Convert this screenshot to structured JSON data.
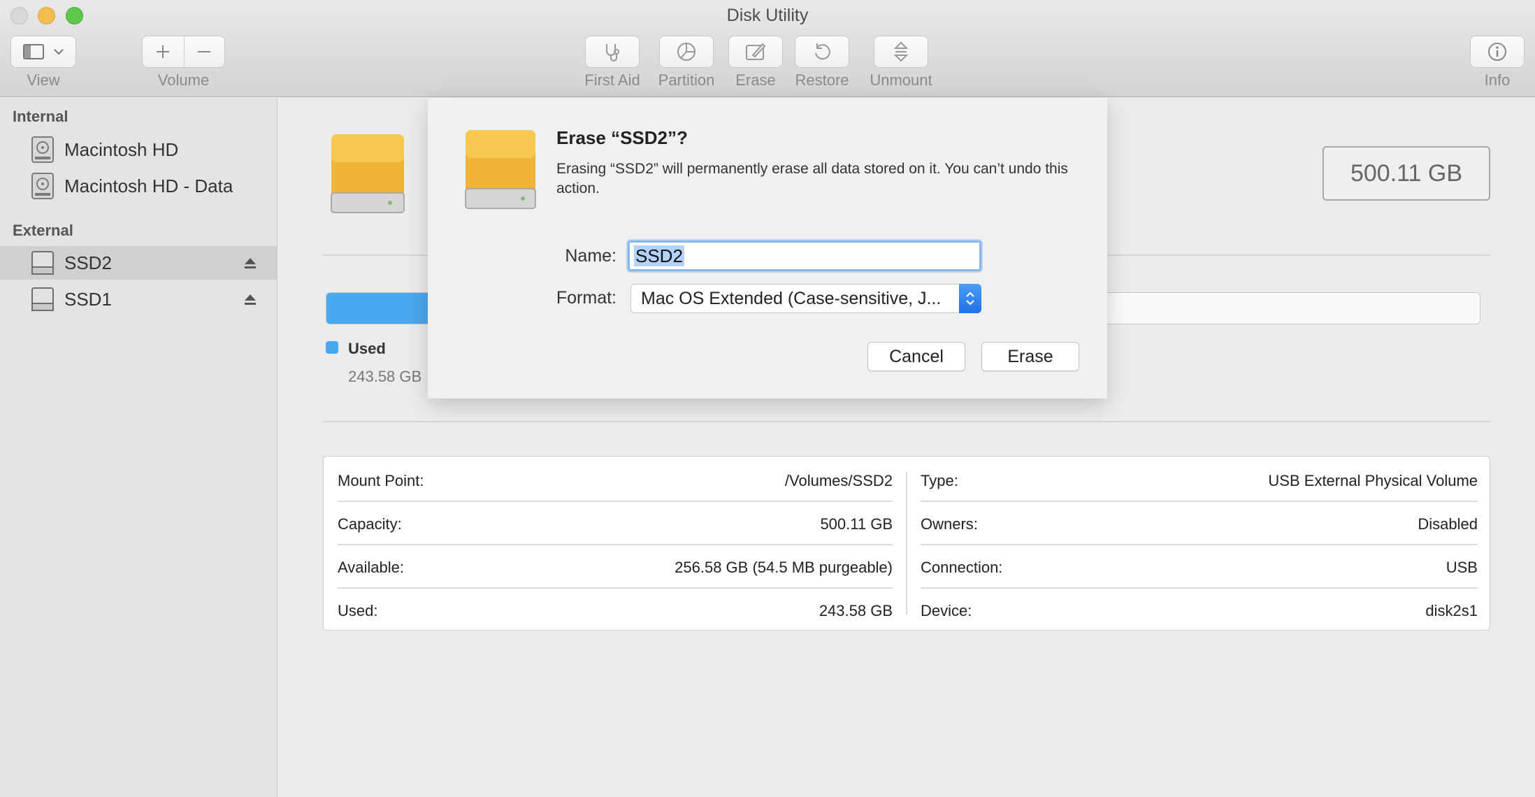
{
  "window": {
    "title": "Disk Utility"
  },
  "toolbar": {
    "view_label": "View",
    "volume_label": "Volume",
    "first_aid_label": "First Aid",
    "partition_label": "Partition",
    "erase_label": "Erase",
    "restore_label": "Restore",
    "unmount_label": "Unmount",
    "info_label": "Info"
  },
  "sidebar": {
    "internal_header": "Internal",
    "external_header": "External",
    "internal_items": [
      {
        "label": "Macintosh HD",
        "icon": "internal-disk-icon"
      },
      {
        "label": "Macintosh HD - Data",
        "icon": "internal-disk-icon"
      }
    ],
    "external_items": [
      {
        "label": "SSD2",
        "icon": "external-disk-icon",
        "selected": true
      },
      {
        "label": "SSD1",
        "icon": "external-disk-icon",
        "selected": false
      }
    ]
  },
  "main": {
    "capacity": "500.11 GB",
    "usage": {
      "used_fraction": 0.487,
      "legend_label": "Used",
      "legend_value": "243.58 GB",
      "color": "#4aa8ef"
    },
    "info_left": [
      {
        "label": "Mount Point:",
        "value": "/Volumes/SSD2"
      },
      {
        "label": "Capacity:",
        "value": "500.11 GB"
      },
      {
        "label": "Available:",
        "value": "256.58 GB (54.5 MB purgeable)"
      },
      {
        "label": "Used:",
        "value": "243.58 GB"
      }
    ],
    "info_right": [
      {
        "label": "Type:",
        "value": "USB External Physical Volume"
      },
      {
        "label": "Owners:",
        "value": "Disabled"
      },
      {
        "label": "Connection:",
        "value": "USB"
      },
      {
        "label": "Device:",
        "value": "disk2s1"
      }
    ]
  },
  "dialog": {
    "title": "Erase “SSD2”?",
    "message": "Erasing “SSD2” will permanently erase all data stored on it. You can’t undo this action.",
    "name_label": "Name:",
    "name_value": "SSD2",
    "format_label": "Format:",
    "format_value": "Mac OS Extended (Case-sensitive, J...",
    "cancel_label": "Cancel",
    "erase_label": "Erase"
  }
}
